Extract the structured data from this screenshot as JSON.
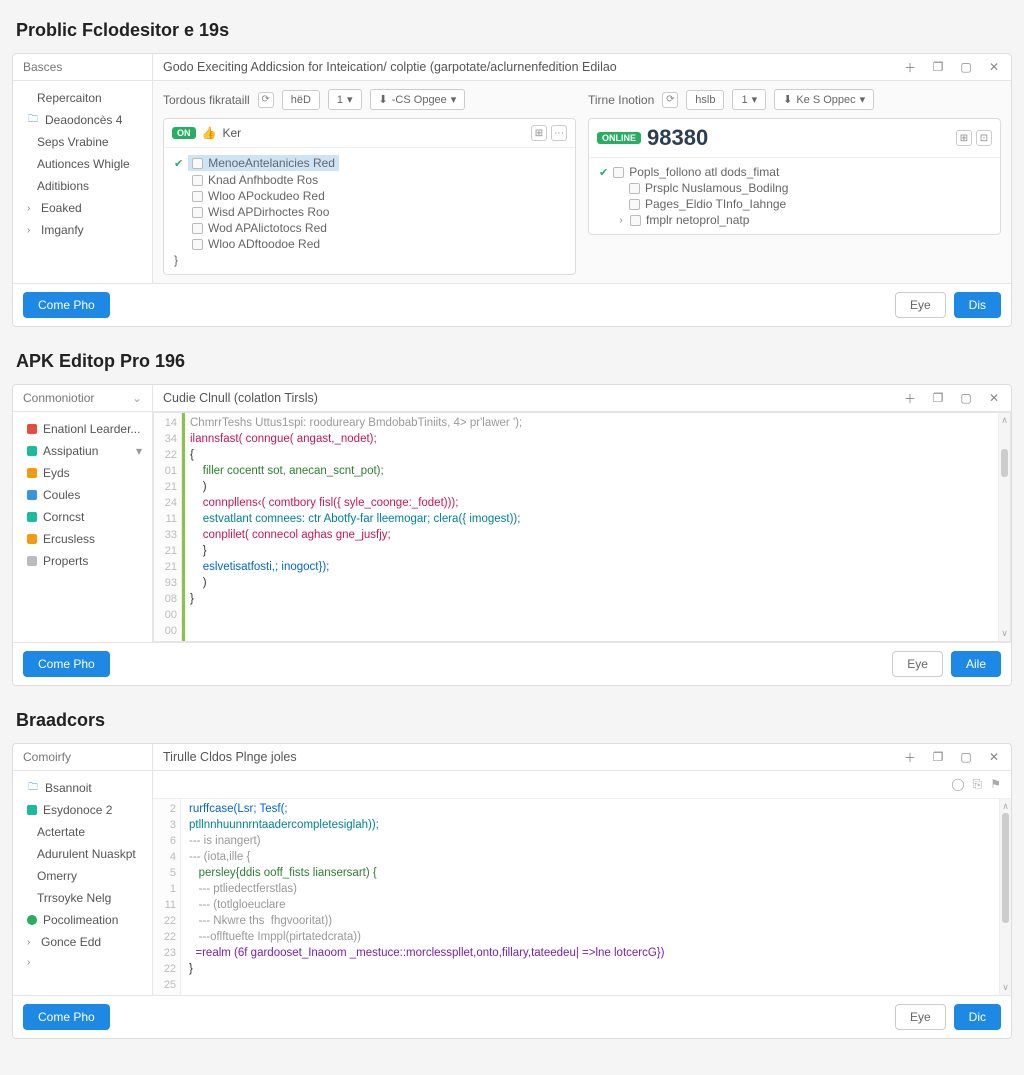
{
  "section1": {
    "title": "Problic Fclodesitor e 19s",
    "sidebar_header": "Basces",
    "main_header": "Godo Execiting Addicsion for Inteication/ colptie (garpotate/aclurnenfedition Edilao",
    "sidebar": [
      {
        "label": "Repercaiton",
        "indent": true
      },
      {
        "label": "Deaodoncès 4",
        "icon": "folder",
        "prefix": "folder"
      },
      {
        "label": "Seps Vrabine",
        "indent": true
      },
      {
        "label": "Autionces Whigle",
        "indent": true
      },
      {
        "label": "Aditibions",
        "indent": true
      },
      {
        "label": "Eoaked",
        "chev": true
      },
      {
        "label": "Imganfy",
        "chev": true
      }
    ],
    "left_tool": {
      "label": "Tordous fikrataill",
      "field": "hëD",
      "select": "1",
      "dropdown": "-CS Opgee"
    },
    "right_tool": {
      "label": "Tirne Inotion",
      "field": "hslb",
      "select": "1",
      "dropdown": "Ke S Oppec"
    },
    "left_card": {
      "badge": "ON",
      "thumb": "👍",
      "title": "Ker",
      "tree": [
        {
          "text": "MenoeAntelanicies Red",
          "sel": true,
          "check": true
        },
        {
          "text": "Knad Anfhbodte Ros"
        },
        {
          "text": "Wloo APockudeo Red"
        },
        {
          "text": "Wisd APDirhoctes Roo"
        },
        {
          "text": "Wod APAlictotocs Red"
        },
        {
          "text": "Wloo ADftoodoe Red"
        },
        {
          "text": "}"
        }
      ]
    },
    "right_card": {
      "badge": "ONLINE",
      "number": "98380",
      "tree": [
        {
          "text": "Popls_follono atl dods_fimat",
          "check": true
        },
        {
          "text": "Prsplc Nuslamous_Bodilng",
          "indent": true
        },
        {
          "text": "Pages_Eldio TInfo_Iahnge",
          "indent": true
        },
        {
          "text": "fmplr netoprol_natp",
          "indent": true,
          "chev": true
        }
      ]
    },
    "footer": {
      "left": "Come Pho",
      "btn1": "Eye",
      "btn2": "Dis"
    }
  },
  "section2": {
    "title": "APK Editop Pro 196",
    "sidebar_header": "Conmoniotior",
    "main_header": "Cudie Clnull (colatlon Tirsls)",
    "sidebar": [
      {
        "label": "Enationl Learder...",
        "icon": "red"
      },
      {
        "label": "Assipatiun",
        "icon": "teal",
        "caret": true
      },
      {
        "label": "Eyds",
        "icon": "yellow"
      },
      {
        "label": "Coules",
        "icon": "blue"
      },
      {
        "label": "Corncst",
        "icon": "teal"
      },
      {
        "label": "Ercusless",
        "icon": "yellow"
      },
      {
        "label": "Properts",
        "icon": "gray"
      }
    ],
    "gutter": [
      "14",
      "34",
      "22",
      "01",
      "21",
      "24",
      "11",
      "33",
      "21",
      "21",
      "93",
      "08",
      "00",
      "00"
    ],
    "code": [
      {
        "t": "ChmrrTeshs Uttus1spi: roodureary BmdobabTiniits, 4> pr'lawer ');",
        "cls": "cm"
      },
      {
        "t": "ilannsfast( conngue( angast,_nodet);",
        "cls": "fn"
      },
      {
        "t": "{",
        "cls": ""
      },
      {
        "t": "    filler cocentt sot, anecan_scnt_pot);",
        "cls": "str"
      },
      {
        "t": "    )",
        "cls": ""
      },
      {
        "t": "    connpllens‹( comtbory fisl({ syle_coonge:_fodet)));",
        "cls": "fn"
      },
      {
        "t": "",
        "cls": ""
      },
      {
        "t": "    estvatlant comnees: ctr Abotfy-far lleemogar; clera({ imogest));",
        "cls": "cyan"
      },
      {
        "t": "    conplilet( connecol aghas gne_jusfjy;",
        "cls": "fn"
      },
      {
        "t": "    }",
        "cls": ""
      },
      {
        "t": "    eslvetisatfosti,; inogoct});",
        "cls": "kw"
      },
      {
        "t": "    )",
        "cls": ""
      },
      {
        "t": "}",
        "cls": ""
      }
    ],
    "footer": {
      "left": "Come Pho",
      "btn1": "Eye",
      "btn2": "Aile"
    }
  },
  "section3": {
    "title": "Braadcors",
    "sidebar_header": "Comoirfy",
    "main_header": "Tirulle Cldos Plnge joles",
    "sidebar": [
      {
        "label": "Bsannoit",
        "icon": "folder"
      },
      {
        "label": "Esydonoce 2",
        "icon": "teal"
      },
      {
        "label": "Actertate",
        "indent": true
      },
      {
        "label": "Adurulent Nuaskpt",
        "indent": true
      },
      {
        "label": "Omerry",
        "indent": true
      },
      {
        "label": "Trrsoyke Nelg",
        "indent": true
      },
      {
        "label": "Pocolimeation",
        "icon": "green"
      },
      {
        "label": "Gonce Edd",
        "chev": true
      },
      {
        "label": "",
        "chev": true
      }
    ],
    "gutter": [
      "2",
      "3",
      "6",
      "4",
      "5",
      "1",
      "11",
      "22",
      "22",
      "23",
      "22",
      "25"
    ],
    "code": [
      {
        "t": "rurffcase(Lsr; Tesf(;",
        "cls": "kw"
      },
      {
        "t": "ptllnnhuunnrntaadercompletesiglah));",
        "cls": "cyan"
      },
      {
        "t": "--- is inangert)",
        "cls": "cm"
      },
      {
        "t": "--- (iota,ille {",
        "cls": "cm"
      },
      {
        "t": "   persley{ddis ooff_fists liansersart) {",
        "cls": "str"
      },
      {
        "t": "   --- ptliedectferstlas)",
        "cls": "cm"
      },
      {
        "t": "   --- (totlgloeuclare",
        "cls": "cm"
      },
      {
        "t": "   --- Nkwre ths  fhgvooritat))",
        "cls": "cm"
      },
      {
        "t": "   ---oflftuefte Imppl(pirtatedcrata))",
        "cls": "cm"
      },
      {
        "t": "  =realm (6f gardooset_Inaoom _mestuce::morclesspllet,onto,fillary,tateedeu| =>lne lotcercG})",
        "cls": "var"
      },
      {
        "t": "}",
        "cls": ""
      }
    ],
    "footer": {
      "left": "Come Pho",
      "btn1": "Eye",
      "btn2": "Dic"
    }
  }
}
